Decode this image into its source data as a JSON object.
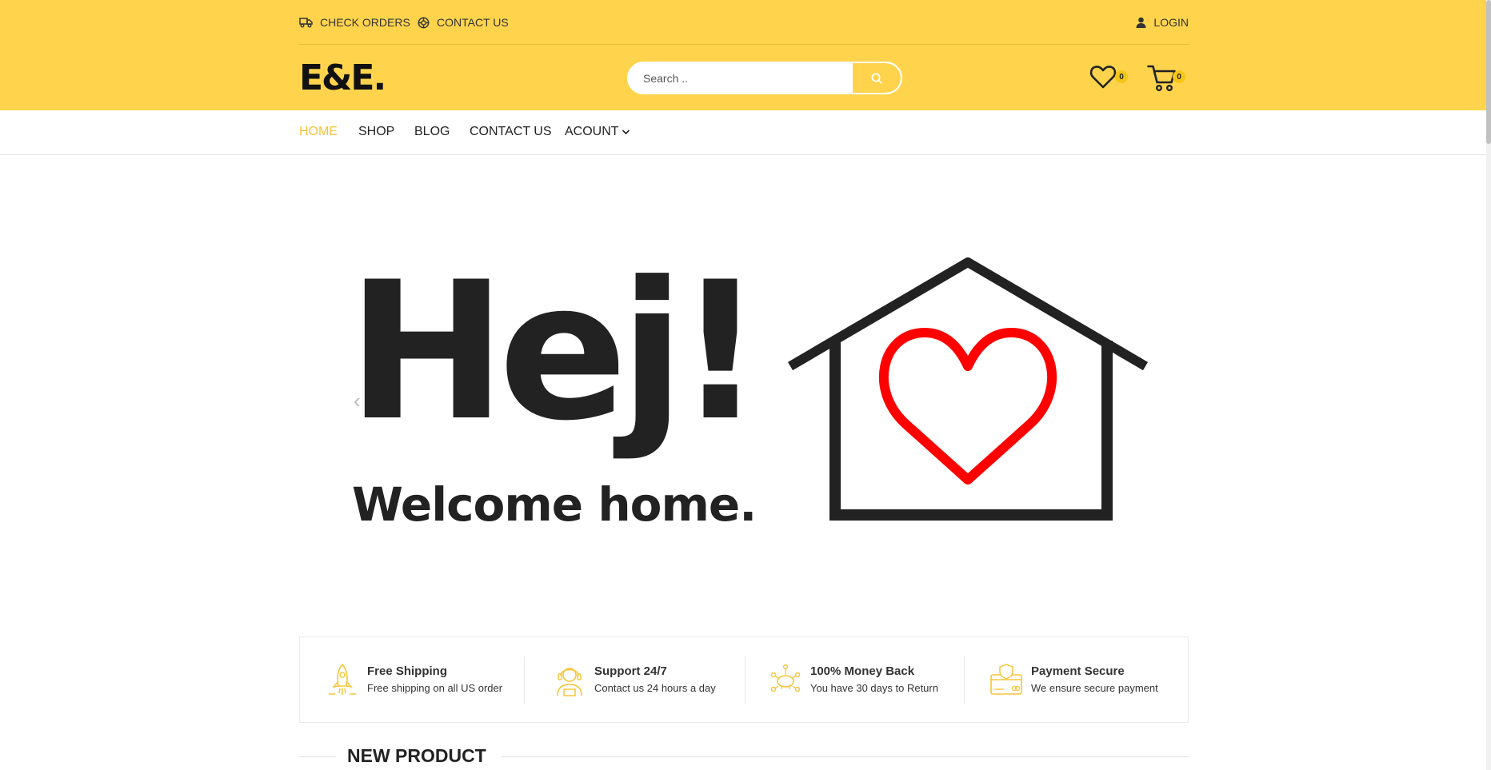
{
  "topbar": {
    "check_orders": "CHECK ORDERS",
    "contact_us": "CONTACT US",
    "login": "LOGIN"
  },
  "header": {
    "logo": "E&E.",
    "search_placeholder": "Search ..",
    "wishlist_count": "0",
    "cart_count": "0"
  },
  "nav": {
    "items": [
      "HOME",
      "SHOP",
      "BLOG",
      "CONTACT US",
      "ACOUNT"
    ],
    "active": "HOME"
  },
  "hero": {
    "headline": "Hej!",
    "subheadline": "Welcome home.",
    "prev_arrow": "‹"
  },
  "features": [
    {
      "title": "Free Shipping",
      "desc": "Free shipping on all US order",
      "icon": "rocket-icon"
    },
    {
      "title": "Support 24/7",
      "desc": "Contact us 24 hours a day",
      "icon": "support-agent-icon"
    },
    {
      "title": "100% Money Back",
      "desc": "You have 30 days to Return",
      "icon": "piggy-bank-icon"
    },
    {
      "title": "Payment Secure",
      "desc": "We ensure secure payment",
      "icon": "secure-card-icon"
    }
  ],
  "section": {
    "title": "NEW PRODUCT"
  },
  "colors": {
    "brand_yellow": "#ffd44c",
    "accent": "#f7c53a",
    "heart_red": "#ff0000",
    "text_dark": "#222222"
  }
}
